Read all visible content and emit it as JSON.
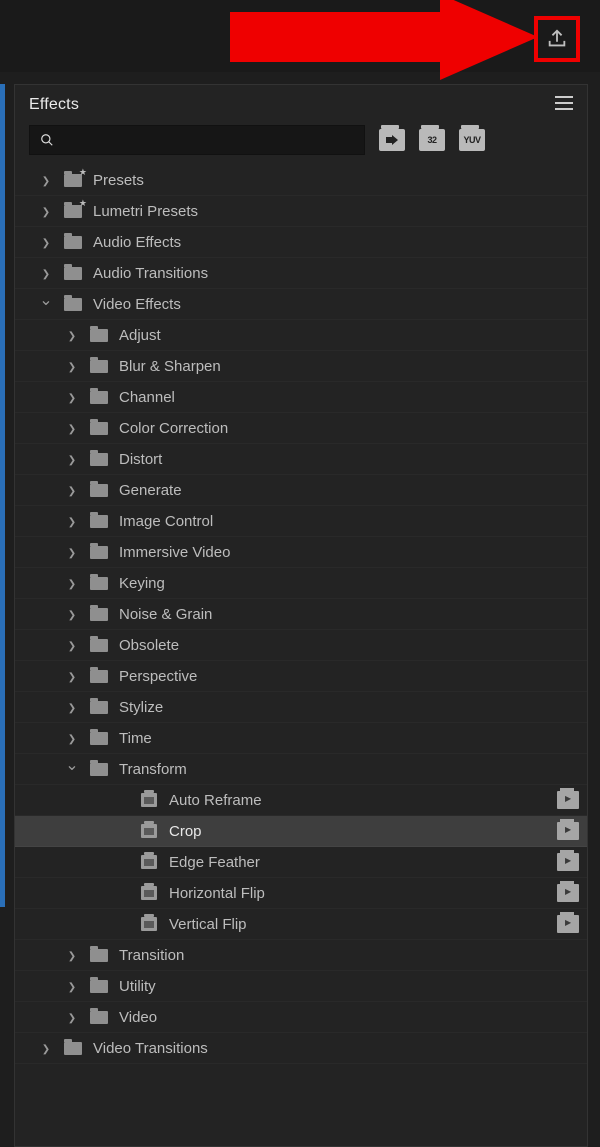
{
  "panel": {
    "title": "Effects"
  },
  "toolbar": {
    "icon1": "fx",
    "icon2": "32",
    "icon3": "YUV"
  },
  "tree": [
    {
      "lvl": 0,
      "chev": "right",
      "icon": "folder-star",
      "label": "Presets"
    },
    {
      "lvl": 0,
      "chev": "right",
      "icon": "folder-star",
      "label": "Lumetri Presets"
    },
    {
      "lvl": 0,
      "chev": "right",
      "icon": "folder",
      "label": "Audio Effects"
    },
    {
      "lvl": 0,
      "chev": "right",
      "icon": "folder",
      "label": "Audio Transitions"
    },
    {
      "lvl": 0,
      "chev": "down",
      "icon": "folder",
      "label": "Video Effects"
    },
    {
      "lvl": 1,
      "chev": "right",
      "icon": "folder",
      "label": "Adjust"
    },
    {
      "lvl": 1,
      "chev": "right",
      "icon": "folder",
      "label": "Blur & Sharpen"
    },
    {
      "lvl": 1,
      "chev": "right",
      "icon": "folder",
      "label": "Channel"
    },
    {
      "lvl": 1,
      "chev": "right",
      "icon": "folder",
      "label": "Color Correction"
    },
    {
      "lvl": 1,
      "chev": "right",
      "icon": "folder",
      "label": "Distort"
    },
    {
      "lvl": 1,
      "chev": "right",
      "icon": "folder",
      "label": "Generate"
    },
    {
      "lvl": 1,
      "chev": "right",
      "icon": "folder",
      "label": "Image Control"
    },
    {
      "lvl": 1,
      "chev": "right",
      "icon": "folder",
      "label": "Immersive Video"
    },
    {
      "lvl": 1,
      "chev": "right",
      "icon": "folder",
      "label": "Keying"
    },
    {
      "lvl": 1,
      "chev": "right",
      "icon": "folder",
      "label": "Noise & Grain"
    },
    {
      "lvl": 1,
      "chev": "right",
      "icon": "folder",
      "label": "Obsolete"
    },
    {
      "lvl": 1,
      "chev": "right",
      "icon": "folder",
      "label": "Perspective"
    },
    {
      "lvl": 1,
      "chev": "right",
      "icon": "folder",
      "label": "Stylize"
    },
    {
      "lvl": 1,
      "chev": "right",
      "icon": "folder",
      "label": "Time"
    },
    {
      "lvl": 1,
      "chev": "down",
      "icon": "folder",
      "label": "Transform"
    },
    {
      "lvl": 2,
      "chev": "none",
      "icon": "effect",
      "label": "Auto Reframe",
      "badge": true
    },
    {
      "lvl": 2,
      "chev": "none",
      "icon": "effect",
      "label": "Crop",
      "badge": true,
      "selected": true
    },
    {
      "lvl": 2,
      "chev": "none",
      "icon": "effect",
      "label": "Edge Feather",
      "badge": true
    },
    {
      "lvl": 2,
      "chev": "none",
      "icon": "effect",
      "label": "Horizontal Flip",
      "badge": true
    },
    {
      "lvl": 2,
      "chev": "none",
      "icon": "effect",
      "label": "Vertical Flip",
      "badge": true
    },
    {
      "lvl": 1,
      "chev": "right",
      "icon": "folder",
      "label": "Transition"
    },
    {
      "lvl": 1,
      "chev": "right",
      "icon": "folder",
      "label": "Utility"
    },
    {
      "lvl": 1,
      "chev": "right",
      "icon": "folder",
      "label": "Video"
    },
    {
      "lvl": 0,
      "chev": "right",
      "icon": "folder",
      "label": "Video Transitions"
    }
  ]
}
